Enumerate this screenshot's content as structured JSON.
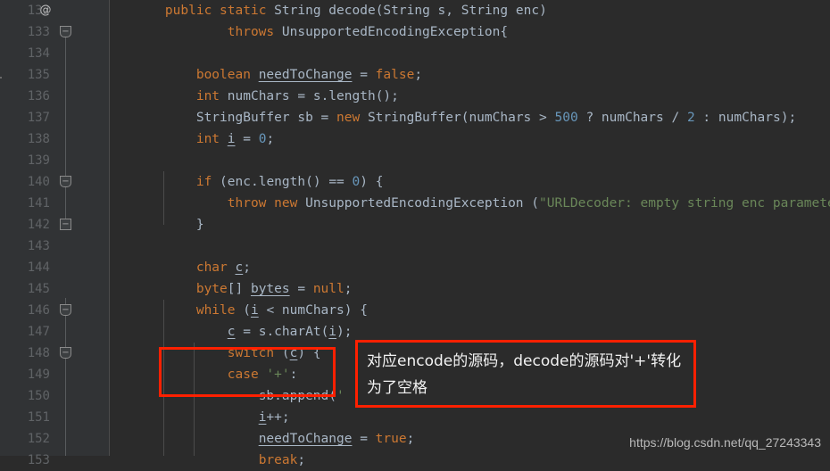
{
  "editor": {
    "theme_name": "darcula",
    "background": "#2b2b2b",
    "gutter_background": "#313335",
    "first_line_number": 132,
    "annotation_marker": "@",
    "lines": [
      {
        "number": "132",
        "marker": "@",
        "fold": "",
        "text": "    public static String decode(String s, String enc)"
      },
      {
        "number": "133",
        "marker": "",
        "fold": "tip",
        "text": "            throws UnsupportedEncodingException{"
      },
      {
        "number": "134",
        "marker": "",
        "fold": "",
        "text": ""
      },
      {
        "number": "135",
        "marker": "",
        "fold": "",
        "text": "        boolean needToChange = false;"
      },
      {
        "number": "136",
        "marker": "",
        "fold": "",
        "text": "        int numChars = s.length();"
      },
      {
        "number": "137",
        "marker": "",
        "fold": "",
        "text": "        StringBuffer sb = new StringBuffer(numChars > 500 ? numChars / 2 : numChars);"
      },
      {
        "number": "138",
        "marker": "",
        "fold": "",
        "text": "        int i = 0;"
      },
      {
        "number": "139",
        "marker": "",
        "fold": "",
        "text": ""
      },
      {
        "number": "140",
        "marker": "",
        "fold": "tip",
        "text": "        if (enc.length() == 0) {"
      },
      {
        "number": "141",
        "marker": "",
        "fold": "",
        "text": "            throw new UnsupportedEncodingException (\"URLDecoder: empty string enc parameter\");"
      },
      {
        "number": "142",
        "marker": "",
        "fold": "end",
        "text": "        }"
      },
      {
        "number": "143",
        "marker": "",
        "fold": "",
        "text": ""
      },
      {
        "number": "144",
        "marker": "",
        "fold": "",
        "text": "        char c;"
      },
      {
        "number": "145",
        "marker": "",
        "fold": "",
        "text": "        byte[] bytes = null;"
      },
      {
        "number": "146",
        "marker": "",
        "fold": "tip",
        "text": "        while (i < numChars) {"
      },
      {
        "number": "147",
        "marker": "",
        "fold": "",
        "text": "            c = s.charAt(i);"
      },
      {
        "number": "148",
        "marker": "",
        "fold": "tip",
        "text": "            switch (c) {"
      },
      {
        "number": "149",
        "marker": "",
        "fold": "",
        "text": "            case '+':"
      },
      {
        "number": "150",
        "marker": "",
        "fold": "",
        "text": "                sb.append(' ');"
      },
      {
        "number": "151",
        "marker": "",
        "fold": "",
        "text": "                i++;"
      },
      {
        "number": "152",
        "marker": "",
        "fold": "",
        "text": "                needToChange = true;"
      },
      {
        "number": "153",
        "marker": "",
        "fold": "",
        "text": "                break;"
      }
    ]
  },
  "annotations": {
    "highlight_color": "#ff2000",
    "case_box_label": "case-plus-highlight-box",
    "note_text": "对应encode的源码，decode的源码对'+'转化为了空格"
  },
  "watermark": {
    "text": "https://blog.csdn.net/qq_27243343"
  }
}
